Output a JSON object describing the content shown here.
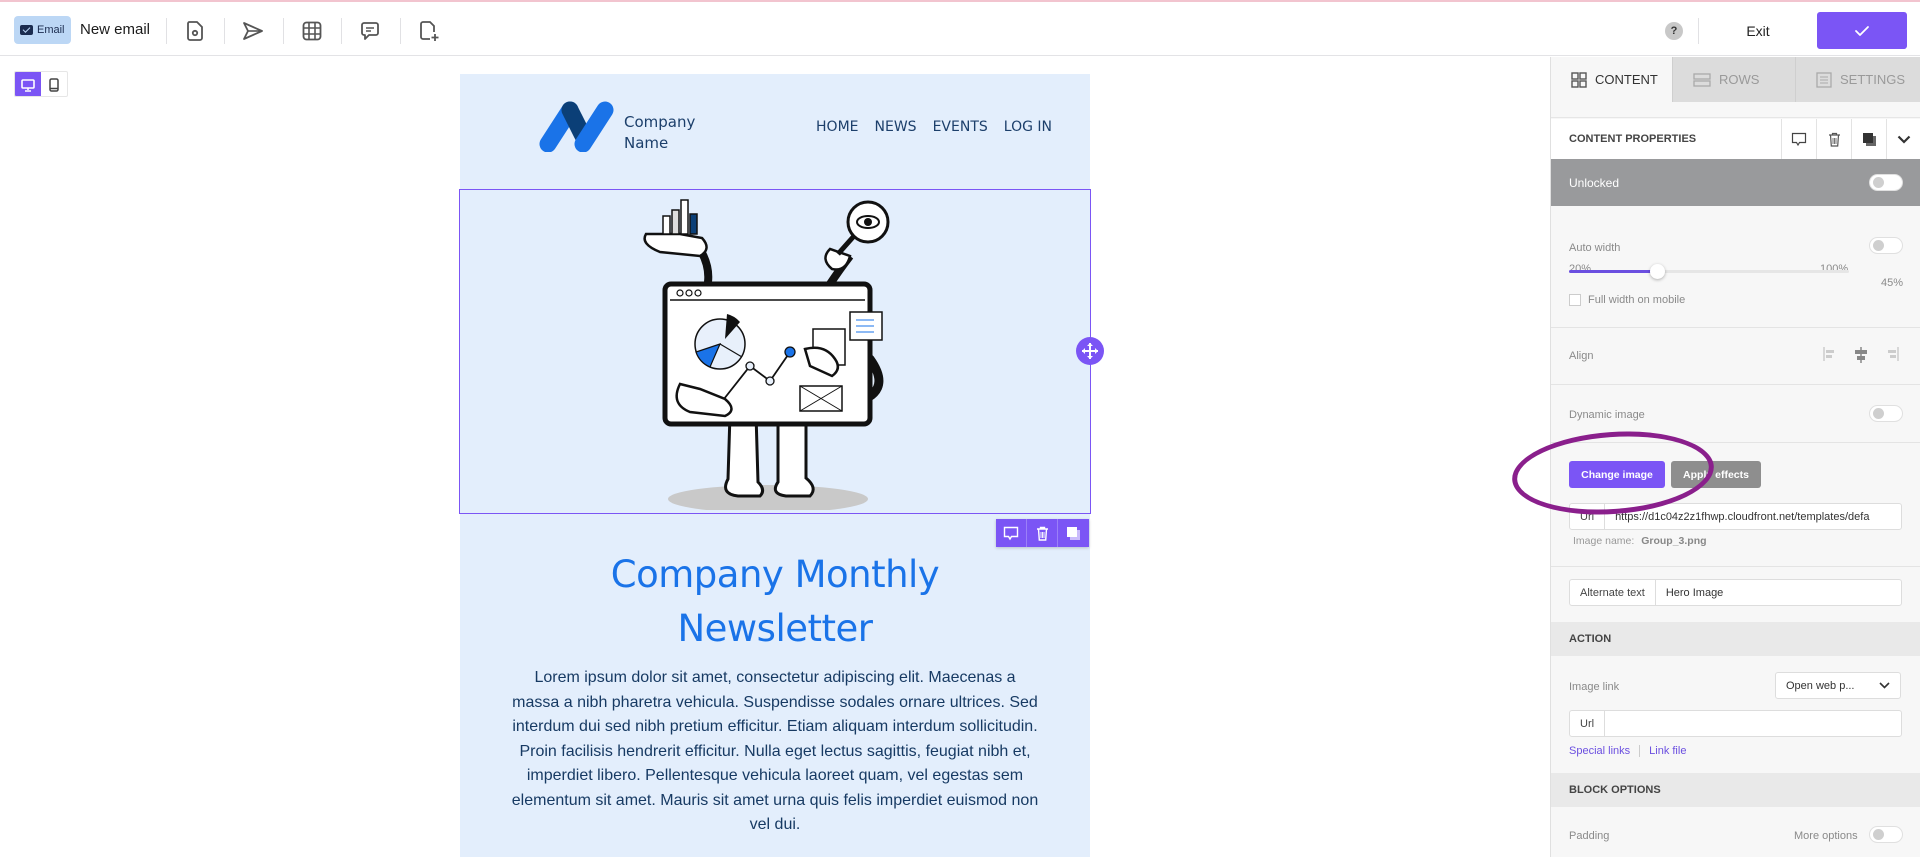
{
  "topbar": {
    "badge_label": "Email",
    "title": "New email",
    "tools": [
      "preview-icon",
      "send-test-icon",
      "grid-icon",
      "comment-icon",
      "add-page-icon"
    ],
    "help_label": "?",
    "exit_label": "Exit",
    "save_icon": "check-icon"
  },
  "device_toggle": {
    "active": "desktop",
    "options": [
      "desktop",
      "mobile"
    ]
  },
  "email": {
    "company_name_line1": "Company",
    "company_name_line2": "Name",
    "nav": [
      "HOME",
      "NEWS",
      "EVENTS",
      "LOG IN"
    ],
    "headline_line1": "Company Monthly",
    "headline_line2": "Newsletter",
    "body": "Lorem ipsum dolor sit amet, consectetur adipiscing elit. Maecenas a massa a nibh pharetra vehicula. Suspendisse sodales ornare ultrices. Sed interdum dui sed nibh pretium efficitur. Etiam aliquam interdum sollicitudin. Proin facilisis hendrerit efficitur. Nulla eget lectus sagittis, feugiat nibh et, imperdiet libero. Pellentesque vehicula laoreet quam, vel egestas sem elementum sit amet. Mauris sit amet urna quis felis imperdiet euismod non vel dui."
  },
  "panel": {
    "tabs": [
      {
        "label": "CONTENT",
        "active": true
      },
      {
        "label": "ROWS",
        "active": false
      },
      {
        "label": "SETTINGS",
        "active": false
      }
    ],
    "content_properties_label": "CONTENT PROPERTIES",
    "lock_label": "Unlocked",
    "auto_width_label": "Auto width",
    "width_min_label": "20%",
    "width_max_label": "100%",
    "width_value_label": "45%",
    "width_value": 45,
    "width_min": 20,
    "width_max": 100,
    "full_width_mobile_label": "Full width on mobile",
    "align_label": "Align",
    "dynamic_image_label": "Dynamic image",
    "change_image_label": "Change image",
    "apply_effects_label": "Apply effects",
    "url_addon": "Url",
    "image_url": "https://d1c04z2z1fhwp.cloudfront.net/templates/defa",
    "image_name_label": "Image name:",
    "image_name": "Group_3.png",
    "alt_text_label": "Alternate text",
    "alt_text_value": "Hero Image",
    "action_header": "ACTION",
    "image_link_label": "Image link",
    "image_link_selected": "Open web p...",
    "link_url_addon": "Url",
    "link_url_value": "",
    "special_links_label": "Special links",
    "link_file_label": "Link file",
    "block_options_header": "BLOCK OPTIONS",
    "padding_label": "Padding",
    "more_options_label": "More options"
  },
  "colors": {
    "accent": "#7b55f5",
    "email_bg": "#e3eefc",
    "headline": "#1a73e8",
    "annotation": "#8a1f8c"
  }
}
